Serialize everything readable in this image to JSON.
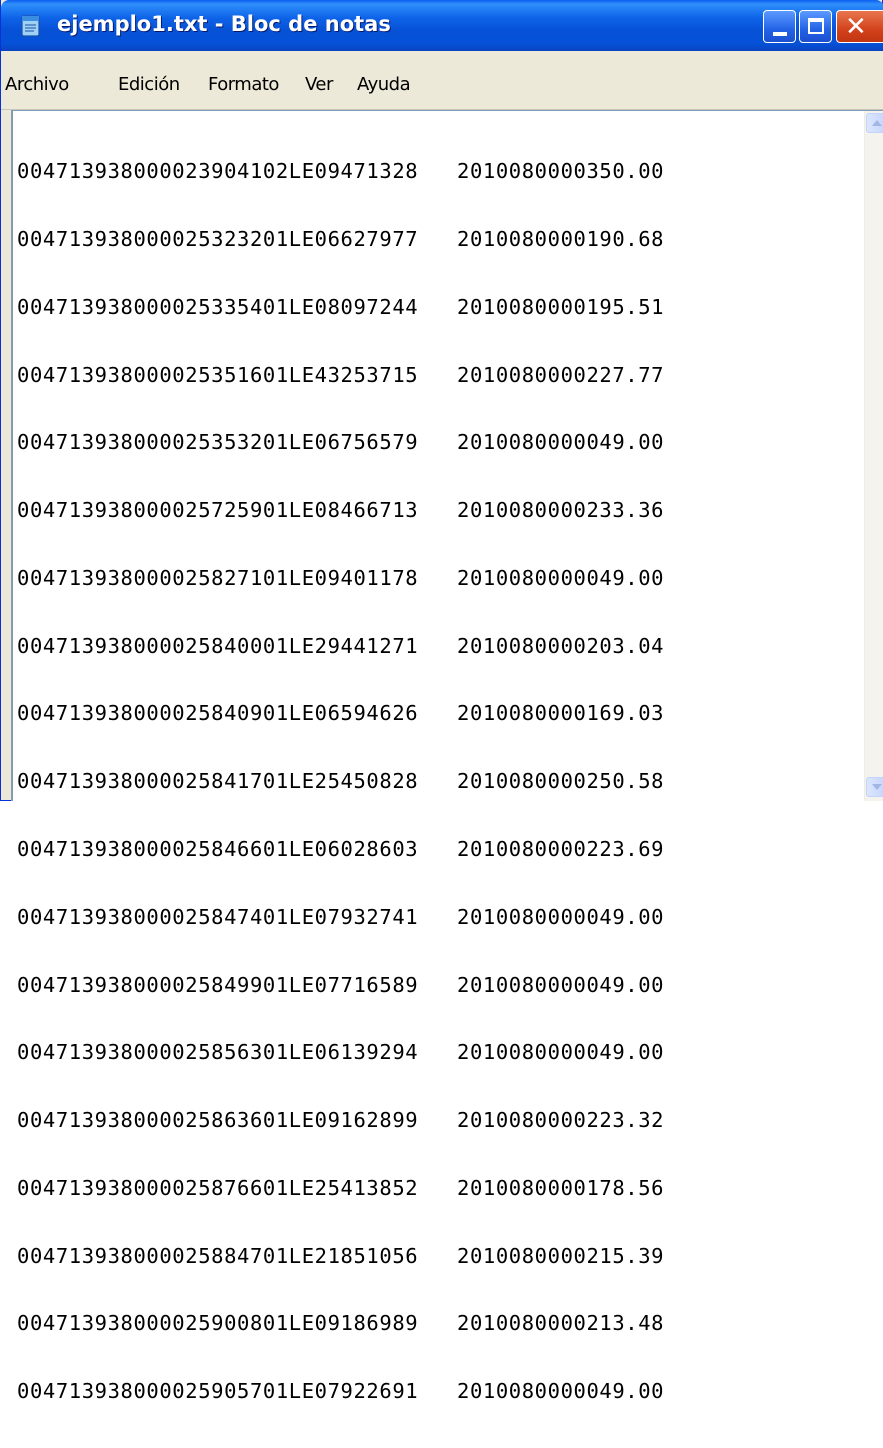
{
  "window": {
    "title": "ejemplo1.txt - Bloc de notas",
    "icon": "notepad-icon"
  },
  "menu": [
    "Archivo",
    "Edición",
    "Formato",
    "Ver",
    "Ayuda"
  ],
  "document": {
    "lines": [
      "004713938000023904102LE09471328   2010080000350.00",
      "004713938000025323201LE06627977   2010080000190.68",
      "004713938000025335401LE08097244   2010080000195.51",
      "004713938000025351601LE43253715   2010080000227.77",
      "004713938000025353201LE06756579   2010080000049.00",
      "004713938000025725901LE08466713   2010080000233.36",
      "004713938000025827101LE09401178   2010080000049.00",
      "004713938000025840001LE29441271   2010080000203.04",
      "004713938000025840901LE06594626   2010080000169.03",
      "004713938000025841701LE25450828   2010080000250.58",
      "004713938000025846601LE06028603   2010080000223.69",
      "004713938000025847401LE07932741   2010080000049.00",
      "004713938000025849901LE07716589   2010080000049.00",
      "004713938000025856301LE06139294   2010080000049.00",
      "004713938000025863601LE09162899   2010080000223.32",
      "004713938000025876601LE25413852   2010080000178.56",
      "004713938000025884701LE21851056   2010080000215.39",
      "004713938000025900801LE09186989   2010080000213.48",
      "004713938000025905701LE07922691   2010080000049.00"
    ]
  },
  "colors": {
    "titlebar": "#0651d6",
    "close_button": "#d2421b",
    "menubar": "#ece9d8"
  }
}
